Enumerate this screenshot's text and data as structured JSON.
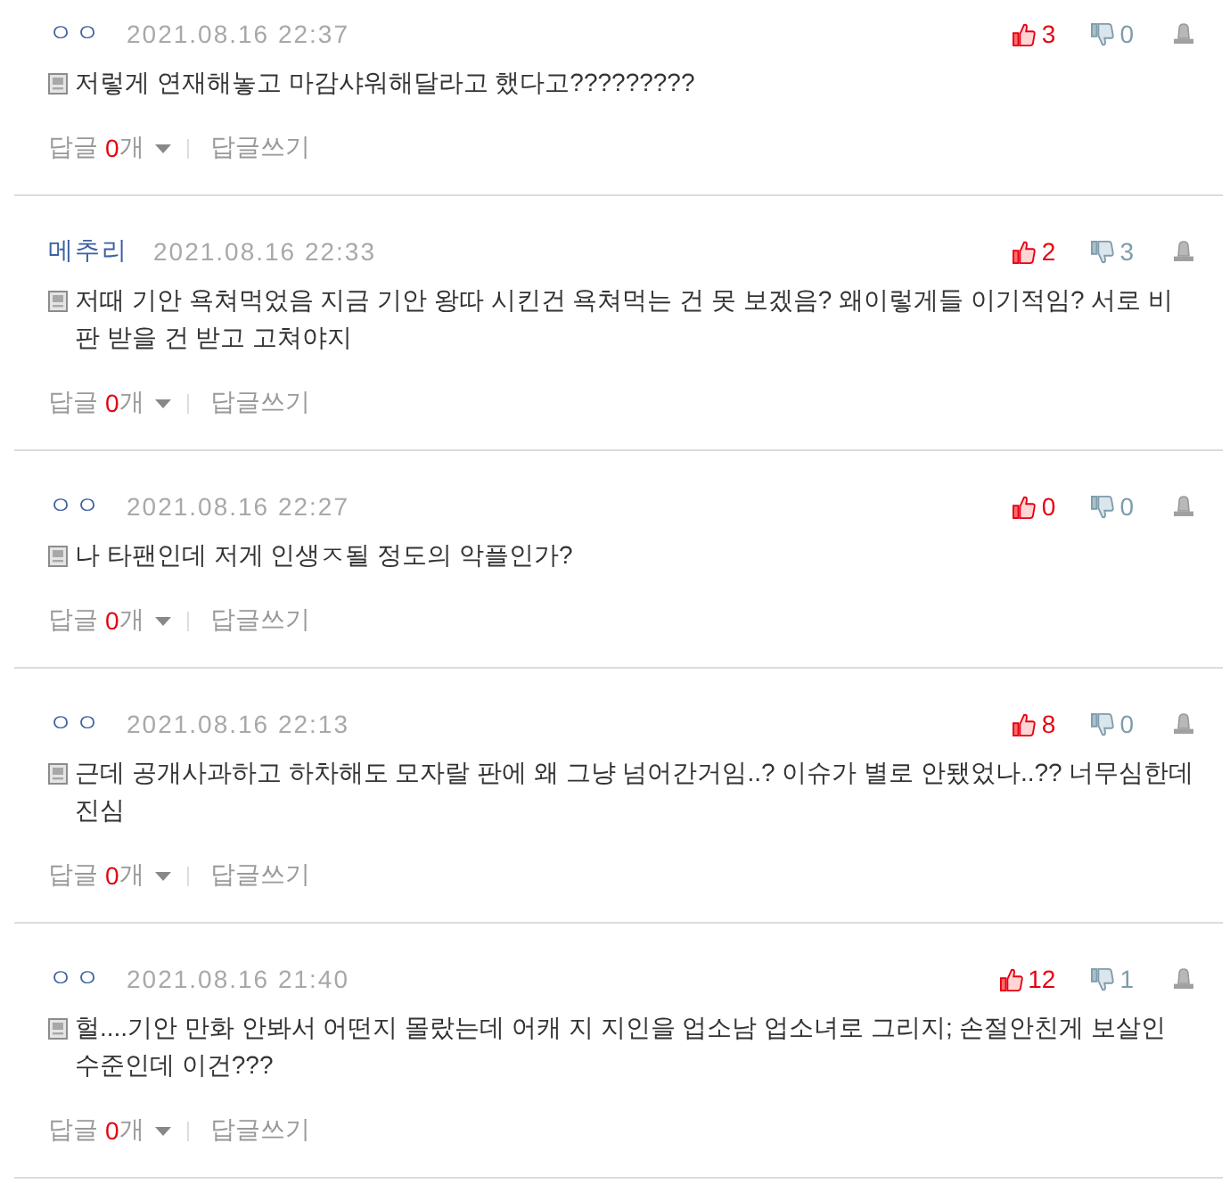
{
  "comments": [
    {
      "author": "ㅇㅇ",
      "date": "2021.08.16 22:37",
      "likes": "3",
      "dislikes": "0",
      "text": "저렇게 연재해놓고 마감샤워해달라고 했다고?????????",
      "reply_label": "답글",
      "reply_count": "0",
      "reply_unit": "개",
      "write_reply": "답글쓰기"
    },
    {
      "author": "메추리",
      "date": "2021.08.16 22:33",
      "likes": "2",
      "dislikes": "3",
      "text": "저때 기안 욕쳐먹었음 지금 기안 왕따 시킨건 욕쳐먹는 건 못 보겠음? 왜이렇게들 이기적임? 서로 비판 받을 건 받고 고쳐야지",
      "reply_label": "답글",
      "reply_count": "0",
      "reply_unit": "개",
      "write_reply": "답글쓰기"
    },
    {
      "author": "ㅇㅇ",
      "date": "2021.08.16 22:27",
      "likes": "0",
      "dislikes": "0",
      "text": "나 타팬인데 저게 인생ㅈ될 정도의 악플인가?",
      "reply_label": "답글",
      "reply_count": "0",
      "reply_unit": "개",
      "write_reply": "답글쓰기"
    },
    {
      "author": "ㅇㅇ",
      "date": "2021.08.16 22:13",
      "likes": "8",
      "dislikes": "0",
      "text": "근데 공개사과하고 하차해도 모자랄 판에 왜 그냥 넘어간거임..? 이슈가 별로 안됐었나..?? 너무심한데 진심",
      "reply_label": "답글",
      "reply_count": "0",
      "reply_unit": "개",
      "write_reply": "답글쓰기"
    },
    {
      "author": "ㅇㅇ",
      "date": "2021.08.16 21:40",
      "likes": "12",
      "dislikes": "1",
      "text": "헐....기안 만화 안봐서 어떤지 몰랐는데 어캐 지 지인을 업소남 업소녀로 그리지; 손절안친게 보살인 수준인데 이건???",
      "reply_label": "답글",
      "reply_count": "0",
      "reply_unit": "개",
      "write_reply": "답글쓰기"
    }
  ]
}
